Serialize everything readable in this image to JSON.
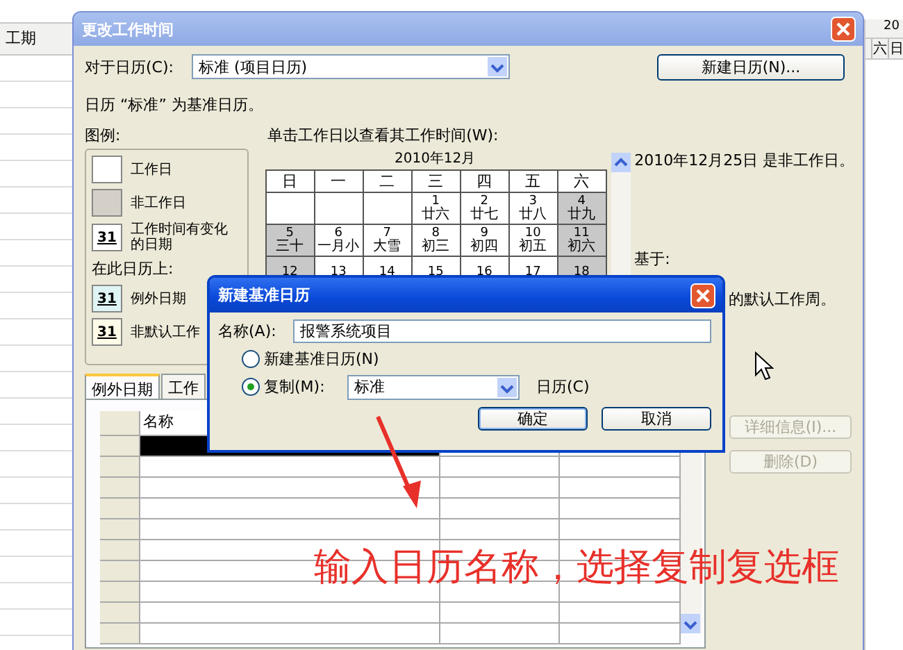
{
  "background": {
    "left_column": {
      "header": "工期"
    },
    "right_strip": {
      "year": "20",
      "days": [
        "六",
        "日"
      ]
    }
  },
  "dialog": {
    "title": "更改工作时间",
    "for_calendar": {
      "label": "对于日历(C):",
      "value": "标准 (项目日历)"
    },
    "new_calendar_button": {
      "label": "新建日历(N)..."
    },
    "base_note": "日历 “标准” 为基准日历。",
    "legend": {
      "title": "图例:",
      "items": [
        {
          "kind": "working",
          "label": "工作日"
        },
        {
          "kind": "nonworking",
          "label": "非工作日"
        },
        {
          "kind": "changed",
          "mark": "31",
          "label": "工作时间有变化的日期"
        },
        {
          "kind": "heading",
          "label": "在此日历上:"
        },
        {
          "kind": "exception",
          "mark": "31",
          "label": "例外日期"
        },
        {
          "kind": "nondefault",
          "mark": "31",
          "label": "非默认工作"
        }
      ]
    },
    "calendar": {
      "instruction": "单击工作日以查看其工作时间(W):",
      "month": "2010年12月",
      "weekdays": [
        "日",
        "一",
        "二",
        "三",
        "四",
        "五",
        "六"
      ],
      "rows": [
        {
          "cells": [
            {
              "working": true
            },
            {
              "working": true
            },
            {
              "working": true
            },
            {
              "day": "1",
              "lunar": "廿六",
              "working": true
            },
            {
              "day": "2",
              "lunar": "廿七",
              "working": true
            },
            {
              "day": "3",
              "lunar": "廿八",
              "working": true
            },
            {
              "day": "4",
              "lunar": "廿九",
              "working": false
            }
          ]
        },
        {
          "cells": [
            {
              "day": "5",
              "lunar": "三十",
              "working": false
            },
            {
              "day": "6",
              "lunar": "一月小",
              "working": true
            },
            {
              "day": "7",
              "lunar": "大雪",
              "working": true
            },
            {
              "day": "8",
              "lunar": "初三",
              "working": true
            },
            {
              "day": "9",
              "lunar": "初四",
              "working": true
            },
            {
              "day": "10",
              "lunar": "初五",
              "working": true
            },
            {
              "day": "11",
              "lunar": "初六",
              "working": false
            }
          ]
        },
        {
          "cells": [
            {
              "day": "12",
              "working": false
            },
            {
              "day": "13",
              "working": true
            },
            {
              "day": "14",
              "working": true
            },
            {
              "day": "15",
              "working": true
            },
            {
              "day": "16",
              "working": true
            },
            {
              "day": "17",
              "working": true
            },
            {
              "day": "18",
              "working": false
            }
          ]
        }
      ]
    },
    "status": "2010年12月25日 是非工作日。",
    "based_on": "基于:",
    "default_week_note": "的默认工作周。",
    "tabs": [
      {
        "label": "例外日期",
        "selected": true
      },
      {
        "label": "工作",
        "selected": false
      }
    ],
    "table": {
      "columns": [
        "名称"
      ],
      "rows": [
        {
          "selected": true
        },
        {
          "selected": false
        },
        {
          "selected": false
        },
        {
          "selected": false
        },
        {
          "selected": false
        },
        {
          "selected": false
        },
        {
          "selected": false
        },
        {
          "selected": false
        },
        {
          "selected": false
        },
        {
          "selected": false
        }
      ]
    },
    "side_buttons": [
      {
        "label": "详细信息(I)...",
        "disabled": true
      },
      {
        "label": "删除(D)",
        "disabled": true
      }
    ]
  },
  "new_base_dialog": {
    "title": "新建基准日历",
    "name": {
      "label": "名称(A):",
      "value": "报警系统项目"
    },
    "options": [
      {
        "label": "新建基准日历(N)",
        "selected": false
      },
      {
        "label": "复制(M):",
        "selected": true
      }
    ],
    "copy_from": {
      "value": "标准",
      "suffix": "日历(C)"
    },
    "buttons": [
      "确定",
      "取消"
    ]
  },
  "annotation": "输入日历名称，选择复制复选框"
}
